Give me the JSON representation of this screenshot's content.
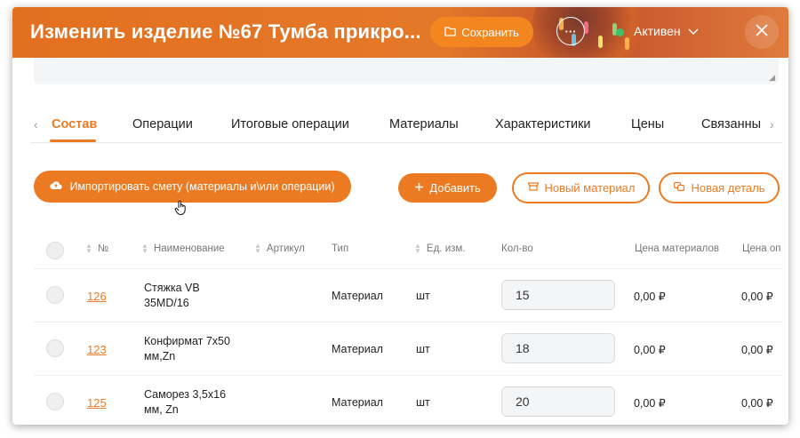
{
  "header": {
    "title": "Изменить изделие №67 Тумба прикро...",
    "save_label": "Сохранить",
    "more_label": "···",
    "status_label": "Активен",
    "status_color": "#3cc36a",
    "accent": "#ec7a22"
  },
  "tabs": [
    {
      "label": "Состав",
      "active": true
    },
    {
      "label": "Операции"
    },
    {
      "label": "Итоговые операции"
    },
    {
      "label": "Материалы"
    },
    {
      "label": "Характеристики"
    },
    {
      "label": "Цены"
    },
    {
      "label": "Связанны"
    }
  ],
  "actions": {
    "import_label": "Импортировать смету (материалы и\\или операции)",
    "add_label": "Добавить",
    "new_material_label": "Новый материал",
    "new_detail_label": "Новая деталь"
  },
  "table": {
    "columns": [
      "№",
      "Наименование",
      "Артикул",
      "Тип",
      "Ед. изм.",
      "Кол-во",
      "Цена материалов",
      "Цена оп"
    ],
    "rows": [
      {
        "num": "126",
        "name": "Стяжка VB 35MD/16",
        "article": "",
        "type": "Материал",
        "unit": "шт",
        "qty": "15",
        "price_materials": "0,00 ₽",
        "price_ops": "0,00 ₽"
      },
      {
        "num": "123",
        "name": "Конфирмат 7х50 мм,Zn",
        "article": "",
        "type": "Материал",
        "unit": "шт",
        "qty": "18",
        "price_materials": "0,00 ₽",
        "price_ops": "0,00 ₽"
      },
      {
        "num": "125",
        "name": "Саморез 3,5х16 мм, Zn",
        "article": "",
        "type": "Материал",
        "unit": "шт",
        "qty": "20",
        "price_materials": "0,00 ₽",
        "price_ops": "0,00 ₽"
      }
    ]
  }
}
